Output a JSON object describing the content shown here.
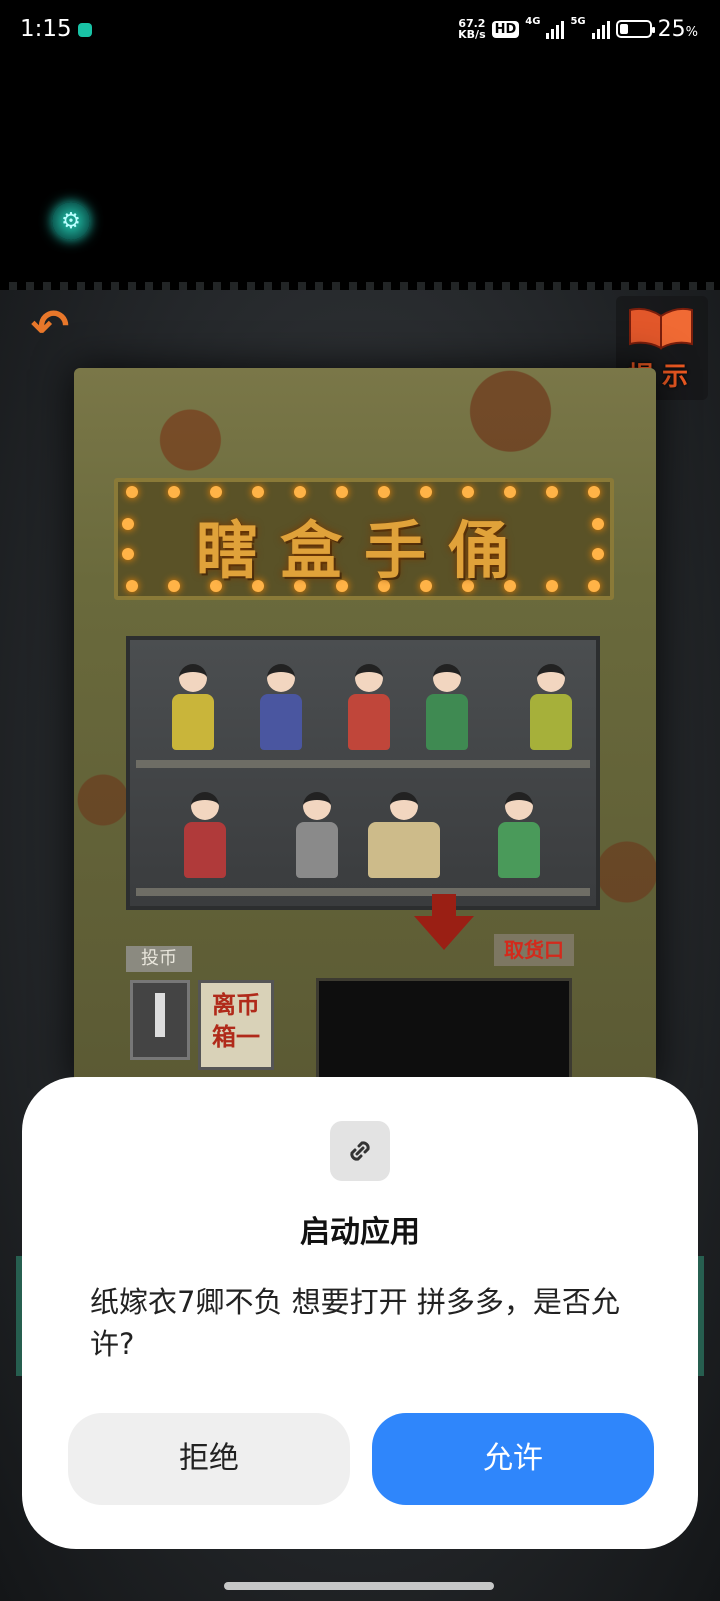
{
  "status_bar": {
    "time": "1:15",
    "net_speed_value": "67.2",
    "net_speed_unit": "KB/s",
    "hd_badge": "HD",
    "network_1": "4G",
    "network_2": "5G",
    "battery_percent": "25",
    "percent_sign": "%"
  },
  "game": {
    "marquee_text": "瞎盒手俑",
    "hint_label": "提示",
    "coin_label": "投币",
    "change_box_line1": "离币",
    "change_box_line2": "箱一",
    "pickup_label": "取货口"
  },
  "dialog": {
    "title": "启动应用",
    "message": "纸嫁衣7卿不负 想要打开 拼多多，是否允许?",
    "deny_label": "拒绝",
    "allow_label": "允许"
  },
  "colors": {
    "allow_button": "#2f86fb",
    "deny_button": "#efefef",
    "hint_text": "#f05a22",
    "settings_glow": "#1fc3b0"
  },
  "icons": [
    "settings-icon",
    "back-arrow-icon",
    "book-icon",
    "link-icon"
  ]
}
